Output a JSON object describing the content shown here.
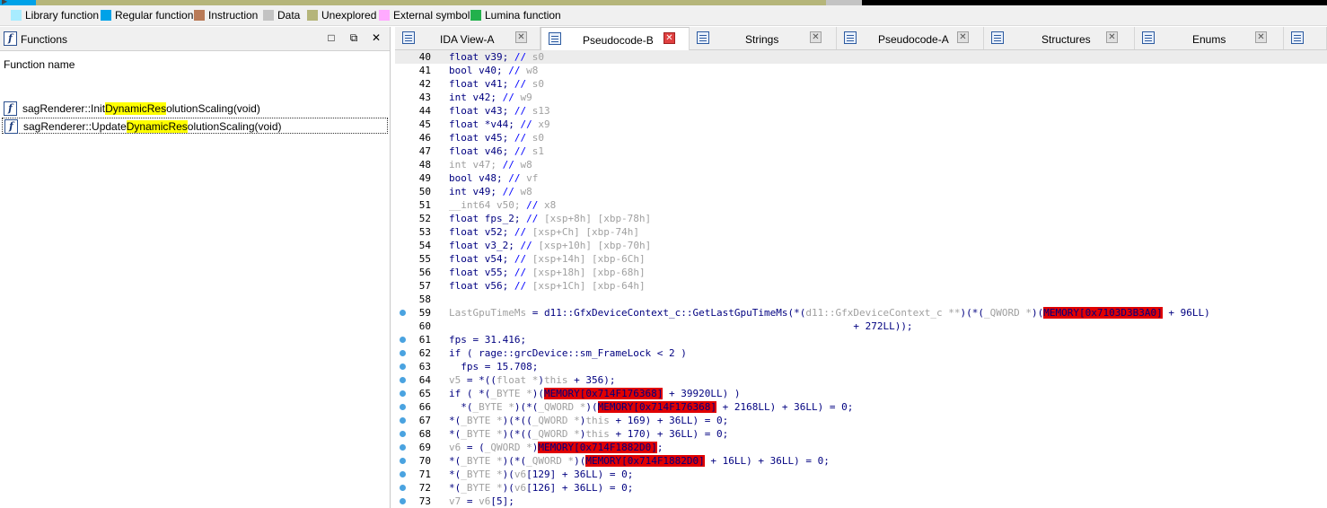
{
  "legend": [
    {
      "label": "Library function",
      "color": "#a8ecff"
    },
    {
      "label": "Regular function",
      "color": "#00a2e8"
    },
    {
      "label": "Instruction",
      "color": "#b97a57"
    },
    {
      "label": "Data",
      "color": "#c3c3c3"
    },
    {
      "label": "Unexplored",
      "color": "#b5b57a"
    },
    {
      "label": "External symbol",
      "color": "#ffaaff"
    },
    {
      "label": "Lumina function",
      "color": "#22b14c"
    }
  ],
  "functions_panel": {
    "title": "Functions",
    "column_header": "Function name",
    "rows": [
      {
        "pre": "sagRenderer::Init",
        "hl1": "Dynamic",
        "mid": "Res",
        "hl2": "",
        "post": "olutionScaling(void)"
      },
      {
        "pre": "sagRenderer::Update",
        "hl1": "Dynamic",
        "mid": "Res",
        "hl2": "",
        "post": "olutionScaling(void)"
      }
    ]
  },
  "tabs": [
    {
      "label": "IDA View-A"
    },
    {
      "label": "Pseudocode-B"
    },
    {
      "label": "Strings"
    },
    {
      "label": "Pseudocode-A"
    },
    {
      "label": "Structures"
    },
    {
      "label": "Enums"
    }
  ],
  "code": [
    {
      "n": "40",
      "bp": false,
      "segs": [
        [
          "t",
          "float v39; "
        ],
        [
          "c",
          "// "
        ],
        [
          "s",
          "s0"
        ]
      ]
    },
    {
      "n": "41",
      "bp": false,
      "segs": [
        [
          "t",
          "bool v40; "
        ],
        [
          "c",
          "// "
        ],
        [
          "s",
          "w8"
        ]
      ]
    },
    {
      "n": "42",
      "bp": false,
      "segs": [
        [
          "t",
          "float v41; "
        ],
        [
          "c",
          "// "
        ],
        [
          "s",
          "s0"
        ]
      ]
    },
    {
      "n": "43",
      "bp": false,
      "segs": [
        [
          "t",
          "int v42; "
        ],
        [
          "c",
          "// "
        ],
        [
          "s",
          "w9"
        ]
      ]
    },
    {
      "n": "44",
      "bp": false,
      "segs": [
        [
          "t",
          "float v43; "
        ],
        [
          "c",
          "// "
        ],
        [
          "s",
          "s13"
        ]
      ]
    },
    {
      "n": "45",
      "bp": false,
      "segs": [
        [
          "t",
          "float *v44; "
        ],
        [
          "c",
          "// "
        ],
        [
          "s",
          "x9"
        ]
      ]
    },
    {
      "n": "46",
      "bp": false,
      "segs": [
        [
          "t",
          "float v45; "
        ],
        [
          "c",
          "// "
        ],
        [
          "s",
          "s0"
        ]
      ]
    },
    {
      "n": "47",
      "bp": false,
      "segs": [
        [
          "t",
          "float v46; "
        ],
        [
          "c",
          "// "
        ],
        [
          "s",
          "s1"
        ]
      ]
    },
    {
      "n": "48",
      "bp": false,
      "segs": [
        [
          "s",
          "int v47; "
        ],
        [
          "c",
          "// "
        ],
        [
          "s",
          "w8"
        ]
      ]
    },
    {
      "n": "49",
      "bp": false,
      "segs": [
        [
          "t",
          "bool v48; "
        ],
        [
          "c",
          "// "
        ],
        [
          "s",
          "vf"
        ]
      ]
    },
    {
      "n": "50",
      "bp": false,
      "segs": [
        [
          "t",
          "int v49; "
        ],
        [
          "c",
          "// "
        ],
        [
          "s",
          "w8"
        ]
      ]
    },
    {
      "n": "51",
      "bp": false,
      "segs": [
        [
          "s",
          "__int64 v50; "
        ],
        [
          "c",
          "// "
        ],
        [
          "s",
          "x8"
        ]
      ]
    },
    {
      "n": "52",
      "bp": false,
      "segs": [
        [
          "t",
          "float fps_2; "
        ],
        [
          "c",
          "// "
        ],
        [
          "s",
          "[xsp+8h] [xbp-78h]"
        ]
      ]
    },
    {
      "n": "53",
      "bp": false,
      "segs": [
        [
          "t",
          "float v52; "
        ],
        [
          "c",
          "// "
        ],
        [
          "s",
          "[xsp+Ch] [xbp-74h]"
        ]
      ]
    },
    {
      "n": "54",
      "bp": false,
      "segs": [
        [
          "t",
          "float v3_2; "
        ],
        [
          "c",
          "// "
        ],
        [
          "s",
          "[xsp+10h] [xbp-70h]"
        ]
      ]
    },
    {
      "n": "55",
      "bp": false,
      "segs": [
        [
          "t",
          "float v54; "
        ],
        [
          "c",
          "// "
        ],
        [
          "s",
          "[xsp+14h] [xbp-6Ch]"
        ]
      ]
    },
    {
      "n": "56",
      "bp": false,
      "segs": [
        [
          "t",
          "float v55; "
        ],
        [
          "c",
          "// "
        ],
        [
          "s",
          "[xsp+18h] [xbp-68h]"
        ]
      ]
    },
    {
      "n": "57",
      "bp": false,
      "segs": [
        [
          "t",
          "float v56; "
        ],
        [
          "c",
          "// "
        ],
        [
          "s",
          "[xsp+1Ch] [xbp-64h]"
        ]
      ]
    },
    {
      "n": "58",
      "bp": false,
      "segs": []
    },
    {
      "n": "59",
      "bp": true,
      "segs": [
        [
          "s",
          "LastGpuTimeMs"
        ],
        [
          "t",
          " = d11::GfxDeviceContext_c::GetLastGpuTimeMs(*("
        ],
        [
          "s",
          "d11::GfxDeviceContext_c **"
        ],
        [
          "t",
          ")(*("
        ],
        [
          "s",
          "_QWORD *"
        ],
        [
          "t",
          ")("
        ],
        [
          "m",
          "MEMORY[0x7103D3B3A0]"
        ],
        [
          "t",
          " + 96LL)"
        ]
      ]
    },
    {
      "n": "60",
      "bp": false,
      "segs": [
        [
          "t",
          "                                                                    + 272LL));"
        ]
      ]
    },
    {
      "n": "61",
      "bp": true,
      "segs": [
        [
          "t",
          "fps = 31.416;"
        ]
      ]
    },
    {
      "n": "62",
      "bp": true,
      "segs": [
        [
          "t",
          "if ( rage::grcDevice::sm_FrameLock < 2 )"
        ]
      ]
    },
    {
      "n": "63",
      "bp": true,
      "segs": [
        [
          "t",
          "  fps = 15.708;"
        ]
      ]
    },
    {
      "n": "64",
      "bp": true,
      "segs": [
        [
          "s",
          "v5"
        ],
        [
          "t",
          " = *(("
        ],
        [
          "s",
          "float *"
        ],
        [
          "t",
          ")"
        ],
        [
          "s",
          "this"
        ],
        [
          "t",
          " + 356);"
        ]
      ]
    },
    {
      "n": "65",
      "bp": true,
      "segs": [
        [
          "t",
          "if ( *("
        ],
        [
          "s",
          "_BYTE *"
        ],
        [
          "t",
          ")("
        ],
        [
          "m",
          "MEMORY[0x714F176368]"
        ],
        [
          "t",
          " + 39920LL) )"
        ]
      ]
    },
    {
      "n": "66",
      "bp": true,
      "segs": [
        [
          "t",
          "  *("
        ],
        [
          "s",
          "_BYTE *"
        ],
        [
          "t",
          ")(*("
        ],
        [
          "s",
          "_QWORD *"
        ],
        [
          "t",
          ")("
        ],
        [
          "m",
          "MEMORY[0x714F176368]"
        ],
        [
          "t",
          " + 2168LL) + 36LL) = 0;"
        ]
      ]
    },
    {
      "n": "67",
      "bp": true,
      "segs": [
        [
          "t",
          "*("
        ],
        [
          "s",
          "_BYTE *"
        ],
        [
          "t",
          ")(*(("
        ],
        [
          "s",
          "_QWORD *"
        ],
        [
          "t",
          ")"
        ],
        [
          "s",
          "this"
        ],
        [
          "t",
          " + 169) + 36LL) = 0;"
        ]
      ]
    },
    {
      "n": "68",
      "bp": true,
      "segs": [
        [
          "t",
          "*("
        ],
        [
          "s",
          "_BYTE *"
        ],
        [
          "t",
          ")(*(("
        ],
        [
          "s",
          "_QWORD *"
        ],
        [
          "t",
          ")"
        ],
        [
          "s",
          "this"
        ],
        [
          "t",
          " + 170) + 36LL) = 0;"
        ]
      ]
    },
    {
      "n": "69",
      "bp": true,
      "segs": [
        [
          "s",
          "v6"
        ],
        [
          "t",
          " = ("
        ],
        [
          "s",
          "_QWORD *"
        ],
        [
          "t",
          ")"
        ],
        [
          "m",
          "MEMORY[0x714F1882D0]"
        ],
        [
          "t",
          ";"
        ]
      ]
    },
    {
      "n": "70",
      "bp": true,
      "segs": [
        [
          "t",
          "*("
        ],
        [
          "s",
          "_BYTE *"
        ],
        [
          "t",
          ")(*("
        ],
        [
          "s",
          "_QWORD *"
        ],
        [
          "t",
          ")("
        ],
        [
          "m",
          "MEMORY[0x714F1882D0]"
        ],
        [
          "t",
          " + 16LL) + 36LL) = 0;"
        ]
      ]
    },
    {
      "n": "71",
      "bp": true,
      "segs": [
        [
          "t",
          "*("
        ],
        [
          "s",
          "_BYTE *"
        ],
        [
          "t",
          ")("
        ],
        [
          "s",
          "v6"
        ],
        [
          "t",
          "[129] + 36LL) = 0;"
        ]
      ]
    },
    {
      "n": "72",
      "bp": true,
      "segs": [
        [
          "t",
          "*("
        ],
        [
          "s",
          "_BYTE *"
        ],
        [
          "t",
          ")("
        ],
        [
          "s",
          "v6"
        ],
        [
          "t",
          "[126] + 36LL) = 0;"
        ]
      ]
    },
    {
      "n": "73",
      "bp": true,
      "segs": [
        [
          "s",
          "v7"
        ],
        [
          "t",
          " = "
        ],
        [
          "s",
          "v6"
        ],
        [
          "t",
          "[5];"
        ]
      ]
    }
  ],
  "colors": {
    "regular_function": "#00a2e8",
    "unexplored": "#b5b57a",
    "memory_highlight": "#e00000",
    "search_highlight": "#ffff00"
  }
}
